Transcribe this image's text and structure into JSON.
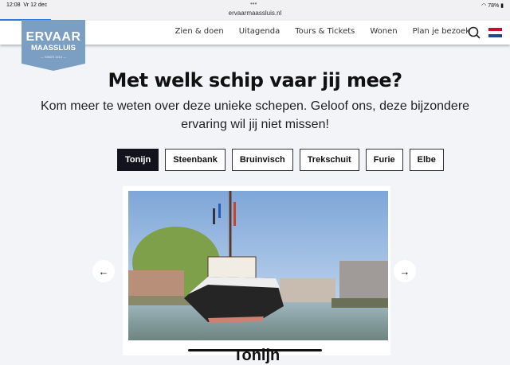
{
  "status": {
    "time": "12:08",
    "date": "Vr 12 dec",
    "url": "ervaarmaassluis.nl",
    "battery": "78%"
  },
  "logo": {
    "line1": "ERVAAR",
    "line2": "MAASSLUIS",
    "line3": "— SINDS 1614 —"
  },
  "nav": [
    {
      "label": "Zien & doen"
    },
    {
      "label": "Uitagenda"
    },
    {
      "label": "Tours & Tickets"
    },
    {
      "label": "Wonen"
    },
    {
      "label": "Plan je bezoek"
    }
  ],
  "page": {
    "title": "Met welk schip vaar jij mee?",
    "subtitle": "Kom meer te weten over deze unieke schepen. Geloof ons, deze bijzondere ervaring wil jij niet missen!"
  },
  "tabs": [
    {
      "label": "Tonijn",
      "active": true
    },
    {
      "label": "Steenbank"
    },
    {
      "label": "Bruinvisch"
    },
    {
      "label": "Trekschuit"
    },
    {
      "label": "Furie"
    },
    {
      "label": "Elbe"
    }
  ],
  "card": {
    "title": "Tonijn"
  },
  "colors": {
    "accent": "#7a9fc2",
    "active_tab": "#12131c"
  }
}
